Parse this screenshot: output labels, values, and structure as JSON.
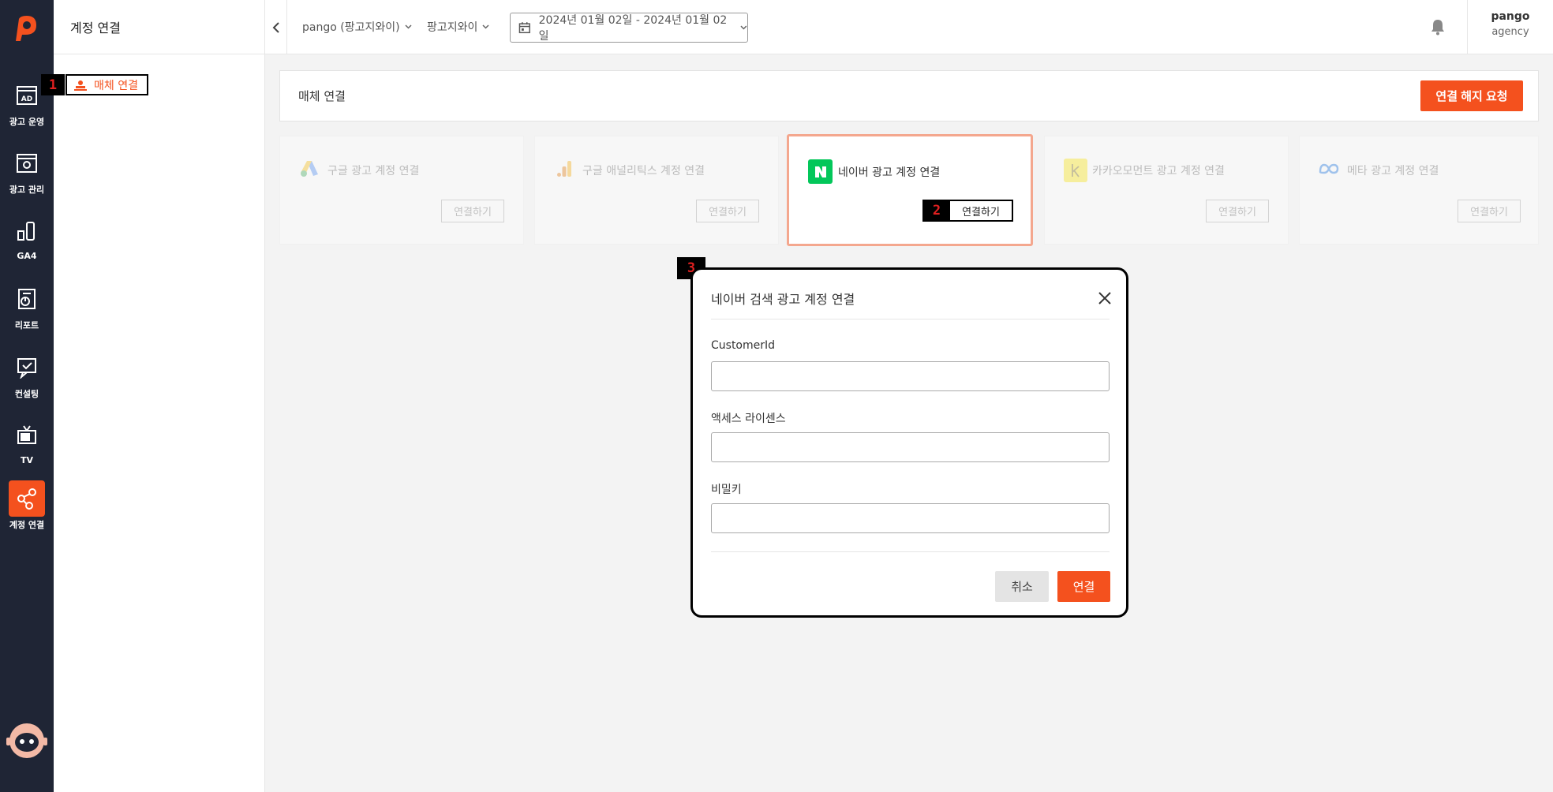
{
  "rail": {
    "items": [
      {
        "label": "광고 운영",
        "icon": "ad-icon"
      },
      {
        "label": "광고 관리",
        "icon": "ad-settings-icon"
      },
      {
        "label": "GA4",
        "icon": "ga4-icon"
      },
      {
        "label": "리포트",
        "icon": "report-icon"
      },
      {
        "label": "컨설팅",
        "icon": "consulting-icon"
      },
      {
        "label": "TV",
        "icon": "tv-icon"
      },
      {
        "label": "계정 연결",
        "icon": "account-link-icon",
        "active": true
      }
    ]
  },
  "sidepanel": {
    "title": "계정 연결",
    "menu_item": "매체 연결",
    "marker": "1"
  },
  "topbar": {
    "account_select": "pango (팡고지와이)",
    "brand_select": "팡고지와이",
    "date_range": "2024년 01월 02일 - 2024년 01월 02일",
    "user_name": "pango",
    "user_role": "agency"
  },
  "header": {
    "title": "매체 연결",
    "disconnect_button": "연결 해지 요청"
  },
  "media_cards": [
    {
      "label": "구글 광고 계정 연결",
      "button": "연결하기",
      "icon": "google-ads-icon",
      "state": "disabled"
    },
    {
      "label": "구글 애널리틱스 계정 연결",
      "button": "연결하기",
      "icon": "google-analytics-icon",
      "state": "disabled"
    },
    {
      "label": "네이버 광고 계정 연결",
      "button": "연결하기",
      "icon": "naver-icon",
      "state": "selected"
    },
    {
      "label": "카카오모먼트 광고 계정 연결",
      "button": "연결하기",
      "icon": "kakao-moment-icon",
      "state": "disabled"
    },
    {
      "label": "메타 광고 계정 연결",
      "button": "연결하기",
      "icon": "meta-icon",
      "state": "disabled"
    }
  ],
  "card_marker": "2",
  "modal": {
    "marker": "3",
    "title": "네이버 검색 광고 계정 연결",
    "fields": [
      {
        "label": "CustomerId",
        "value": ""
      },
      {
        "label": "액세스 라이센스",
        "value": ""
      },
      {
        "label": "비밀키",
        "value": ""
      }
    ],
    "cancel_button": "취소",
    "connect_button": "연결"
  },
  "colors": {
    "accent": "#f4511e",
    "rail_bg": "#1f2535",
    "naver_green": "#03c75a"
  }
}
